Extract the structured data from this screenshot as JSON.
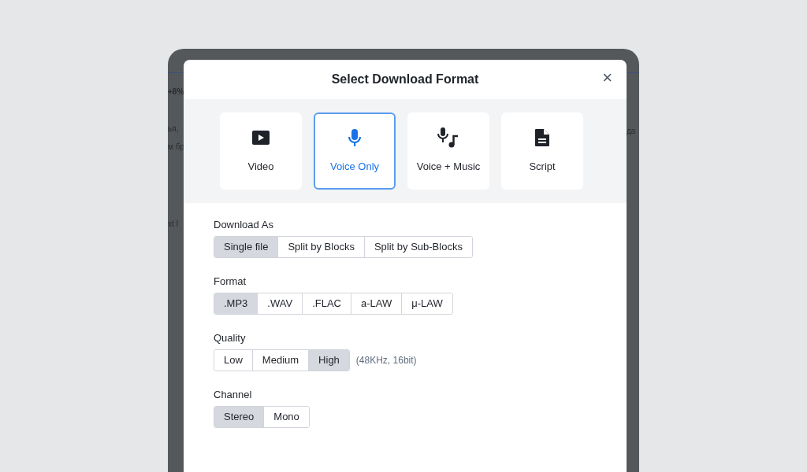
{
  "background_page": {
    "left_fragments": [
      "+8%",
      "ья,",
      "м бр",
      "xt I"
    ],
    "right_fragments": [
      "да"
    ]
  },
  "dialog": {
    "title": "Select Download Format",
    "close": "×"
  },
  "formats": [
    {
      "kind": "video",
      "label": "Video",
      "selected": false
    },
    {
      "kind": "voice",
      "label": "Voice Only",
      "selected": true
    },
    {
      "kind": "voice_music",
      "label": "Voice + Music",
      "selected": false
    },
    {
      "kind": "script",
      "label": "Script",
      "selected": false
    }
  ],
  "groups": [
    {
      "label": "Download As",
      "options": [
        {
          "label": "Single file",
          "selected": true
        },
        {
          "label": "Split by Blocks",
          "selected": false
        },
        {
          "label": "Split by Sub-Blocks",
          "selected": false
        }
      ]
    },
    {
      "label": "Format",
      "options": [
        {
          "label": ".MP3",
          "selected": true
        },
        {
          "label": ".WAV",
          "selected": false
        },
        {
          "label": ".FLAC",
          "selected": false
        },
        {
          "label": "a-LAW",
          "selected": false
        },
        {
          "label": "μ-LAW",
          "selected": false
        }
      ]
    },
    {
      "label": "Quality",
      "options": [
        {
          "label": "Low",
          "selected": false
        },
        {
          "label": "Medium",
          "selected": false
        },
        {
          "label": "High",
          "selected": true
        }
      ],
      "note": "(48KHz, 16bit)"
    },
    {
      "label": "Channel",
      "options": [
        {
          "label": "Stereo",
          "selected": true
        },
        {
          "label": "Mono",
          "selected": false
        }
      ]
    }
  ]
}
